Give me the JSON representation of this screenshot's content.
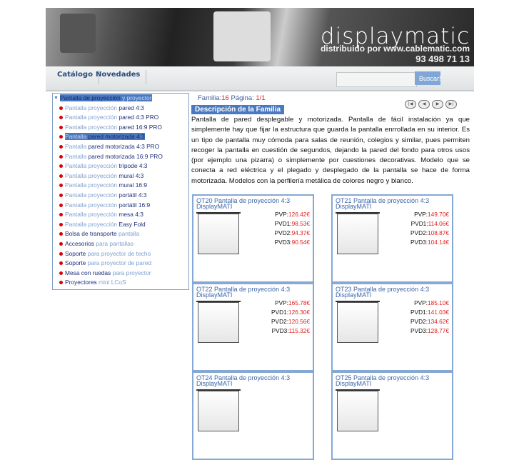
{
  "header": {
    "logo": "displaymatic",
    "tagline": "distribuido por www.cablematic.com",
    "phone": "93 498 71 13"
  },
  "nav": {
    "items": [
      "Catálogo",
      "Novedades"
    ],
    "search_placeholder": "",
    "search_button": "Buscar!"
  },
  "sidebar": {
    "root": {
      "a": "Pantalla de proyección",
      "b": "y proyector"
    },
    "items": [
      {
        "a": "Pantalla proyección",
        "b": "pared 4:3",
        "sa": "lt",
        "sb": "dk"
      },
      {
        "a": "Pantalla proyección",
        "b": "pared 4:3 PRO",
        "sa": "lt",
        "sb": "dk"
      },
      {
        "a": "Pantalla proyección",
        "b": "pared 16:9 PRO",
        "sa": "lt",
        "sb": "dk"
      },
      {
        "a": "Pantalla",
        "b": "pared motorizada 4:3",
        "sa": "lt",
        "sb": "dk",
        "selected": true
      },
      {
        "a": "Pantalla",
        "b": "pared motorizada 4:3 PRO",
        "sa": "lt",
        "sb": "dk"
      },
      {
        "a": "Pantalla",
        "b": "pared motorizada 16:9 PRO",
        "sa": "lt",
        "sb": "dk"
      },
      {
        "a": "Pantalla proyección",
        "b": "trípode 4:3",
        "sa": "lt",
        "sb": "dk"
      },
      {
        "a": "Pantalla proyección",
        "b": "mural 4:3",
        "sa": "lt",
        "sb": "dk"
      },
      {
        "a": "Pantalla proyección",
        "b": "mural 16:9",
        "sa": "lt",
        "sb": "dk"
      },
      {
        "a": "Pantalla proyección",
        "b": "portátil 4:3",
        "sa": "lt",
        "sb": "dk"
      },
      {
        "a": "Pantalla proyección",
        "b": "portátil 16:9",
        "sa": "lt",
        "sb": "dk"
      },
      {
        "a": "Pantalla proyección",
        "b": "mesa 4:3",
        "sa": "lt",
        "sb": "dk"
      },
      {
        "a": "Pantalla proyección",
        "b": "Easy Fold",
        "sa": "lt",
        "sb": "dk"
      },
      {
        "a": "Bolsa de transporte",
        "b": "pantalla",
        "sa": "dk",
        "sb": "lt"
      },
      {
        "a": "Accesorios",
        "b": "para pantallas",
        "sa": "dk",
        "sb": "lt"
      },
      {
        "a": "Soporte",
        "b": "para proyector de techo",
        "sa": "dk",
        "sb": "lt"
      },
      {
        "a": "Soporte",
        "b": "para proyector de pared",
        "sa": "dk",
        "sb": "lt"
      },
      {
        "a": "Mesa con ruedas",
        "b": "para proyector",
        "sa": "dk",
        "sb": "lt"
      },
      {
        "a": "Proyectores",
        "b": "mini LCoS",
        "sa": "dk",
        "sb": "lt"
      }
    ]
  },
  "main": {
    "familia_label": "Familia:",
    "familia": "16",
    "pagina_label": " Página: ",
    "pagina": "1/1",
    "desc_title": "Descripción de la Familia",
    "desc": "Pantalla de pared desplegable y motorizada. Pantalla de fácil instalación ya que simplemente hay que fijar la estructura que guarda la pantalla enrrollada en su interior. Es un tipo de pantalla muy cómoda para salas de reunión, colegios y similar, pues permiten recoger la pantalla en cuestión de segundos, dejando la pared del fondo para otros usos (por ejemplo una pizarra) o simplemente por cuestiones decorativas. Modelo que se conecta a red eléctrica y el plegado y desplegado de la pantalla se hace de forma motorizada. Modelos con la perfilería metálica de colores negro y blanco.",
    "products": [
      {
        "title": "OT20 Pantalla de proyección 4:3 DisplayMATI",
        "prices": [
          [
            "PVP:",
            "126.42€"
          ],
          [
            "PVD1:",
            "98.53€"
          ],
          [
            "PVD2:",
            "94.37€"
          ],
          [
            "PVD3:",
            "90.54€"
          ]
        ]
      },
      {
        "title": "OT21 Pantalla de proyección 4:3 DisplayMATI",
        "prices": [
          [
            "PVP:",
            "149.70€"
          ],
          [
            "PVD1:",
            "114.06€"
          ],
          [
            "PVD2:",
            "108.87€"
          ],
          [
            "PVD3:",
            "104.14€"
          ]
        ]
      },
      {
        "title": "OT22 Pantalla de proyección 4:3 DisplayMATI",
        "prices": [
          [
            "PVP:",
            "165.78€"
          ],
          [
            "PVD1:",
            "126.30€"
          ],
          [
            "PVD2:",
            "120.56€"
          ],
          [
            "PVD3:",
            "115.32€"
          ]
        ]
      },
      {
        "title": "OT23 Pantalla de proyección 4:3 DisplayMATI",
        "prices": [
          [
            "PVP:",
            "185.10€"
          ],
          [
            "PVD1:",
            "141.03€"
          ],
          [
            "PVD2:",
            "134.62€"
          ],
          [
            "PVD3:",
            "128.77€"
          ]
        ]
      },
      {
        "title": "OT24 Pantalla de proyección 4:3 DisplayMATI",
        "prices": []
      },
      {
        "title": "OT25 Pantalla de proyección 4:3 DisplayMATI",
        "prices": []
      }
    ]
  }
}
